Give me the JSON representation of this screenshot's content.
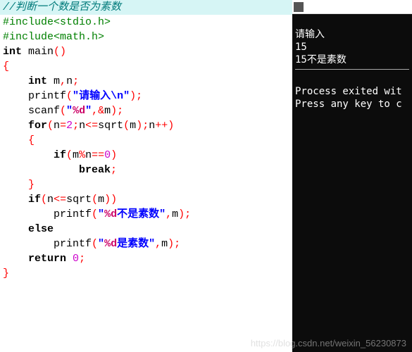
{
  "editor": {
    "lines": [
      {
        "comment": "//判断一个数是否为素数",
        "highlight": true
      },
      {
        "preproc": "#include<stdio.h>"
      },
      {
        "preproc": "#include<math.h>"
      },
      {
        "type": "main_decl",
        "kw": "int",
        "func": " main",
        "paren_open": "(",
        "paren_close": ")"
      },
      {
        "brace": "{"
      },
      {
        "type": "decl",
        "indent": "    ",
        "kw": "int",
        "rest": " m",
        "comma": ",",
        "rest2": "n",
        "semi": ";"
      },
      {
        "type": "printf1",
        "indent": "    ",
        "func": "printf",
        "po": "(",
        "q1": "\"",
        "str": "请输入",
        "esc": "\\n",
        "q2": "\"",
        "pc": ")",
        "semi": ";"
      },
      {
        "type": "scanf",
        "indent": "    ",
        "func": "scanf",
        "po": "(",
        "q1": "\"",
        "fmt": "%d",
        "q2": "\"",
        "comma": ",",
        "amp": "&",
        "var": "m",
        "pc": ")",
        "semi": ";"
      },
      {
        "type": "for",
        "indent": "    ",
        "kw": "for",
        "po": "(",
        "v1": "n",
        "eq1": "=",
        "n1": "2",
        "semi1": ";",
        "v2": "n",
        "op2": "<=",
        "f2": "sqrt",
        "po2": "(",
        "v3": "m",
        "pc2": ")",
        "semi2": ";",
        "v4": "n",
        "inc": "++",
        "pc": ")"
      },
      {
        "indent": "    ",
        "brace": "{"
      },
      {
        "type": "if_mod",
        "indent": "        ",
        "kw": "if",
        "po": "(",
        "v1": "m",
        "op": "%",
        "v2": "n",
        "eq": "==",
        "n1": "0",
        "pc": ")"
      },
      {
        "type": "break",
        "indent": "            ",
        "kw": "break",
        "semi": ";"
      },
      {
        "indent": "    ",
        "brace": "}"
      },
      {
        "type": "if_sqrt",
        "indent": "    ",
        "kw": "if",
        "po": "(",
        "v1": "n",
        "op": "<=",
        "f": "sqrt",
        "po2": "(",
        "v2": "m",
        "pc2": ")",
        "pc": ")"
      },
      {
        "type": "printf_fmt",
        "indent": "        ",
        "func": "printf",
        "po": "(",
        "q1": "\"",
        "fmt": "%d",
        "str": "不是素数",
        "q2": "\"",
        "comma": ",",
        "var": "m",
        "pc": ")",
        "semi": ";"
      },
      {
        "indent": "    ",
        "kw": "else"
      },
      {
        "type": "printf_fmt",
        "indent": "        ",
        "func": "printf",
        "po": "(",
        "q1": "\"",
        "fmt": "%d",
        "str": "是素数",
        "q2": "\"",
        "comma": ",",
        "var": "m",
        "pc": ")",
        "semi": ";"
      },
      {
        "type": "return",
        "indent": "    ",
        "kw": "return",
        "sp": " ",
        "n": "0",
        "semi": ";"
      },
      {
        "brace": "}"
      }
    ]
  },
  "console": {
    "title_fragment": "",
    "output": [
      "请输入",
      "15",
      "15不是素数"
    ],
    "footer": [
      "Process exited wit",
      "Press any key to c"
    ]
  },
  "watermark": "https://blog.csdn.net/weixin_56230873"
}
